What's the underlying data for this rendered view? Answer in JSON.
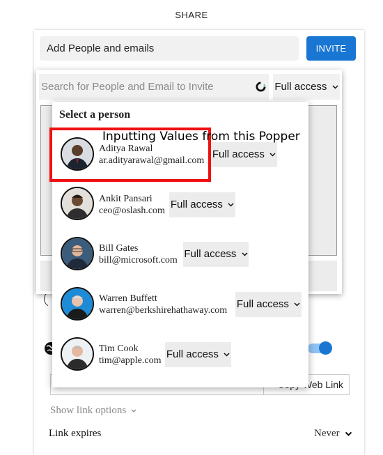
{
  "header": {
    "title": "SHARE"
  },
  "add_people": {
    "placeholder": "Add People and emails",
    "invite_label": "INVITE"
  },
  "search": {
    "placeholder": "Search for People and Email to Invite",
    "access_label": "Full access"
  },
  "popper": {
    "heading": "Select a person",
    "people": [
      {
        "name": "Aditya Rawal",
        "email": "ar.adityarawal@gmail.com",
        "access": "Full access"
      },
      {
        "name": "Ankit Pansari",
        "email": "ceo@oslash.com",
        "access": "Full access"
      },
      {
        "name": "Bill Gates",
        "email": "bill@microsoft.com",
        "access": "Full access"
      },
      {
        "name": "Warren Buffett",
        "email": "warren@berkshirehathaway.com",
        "access": "Full access"
      },
      {
        "name": "Tim Cook",
        "email": "tim@apple.com",
        "access": "Full access"
      }
    ]
  },
  "link": {
    "copy_label": "Copy Web Link",
    "show_options": "Show link options",
    "expires_label": "Link expires",
    "expires_value": "Never"
  },
  "annotation": {
    "text": "Inputting Values from this Popper"
  },
  "colors": {
    "primary": "#1976d2",
    "highlight": "#ee1111",
    "toggle_track": "#90c2f5"
  }
}
